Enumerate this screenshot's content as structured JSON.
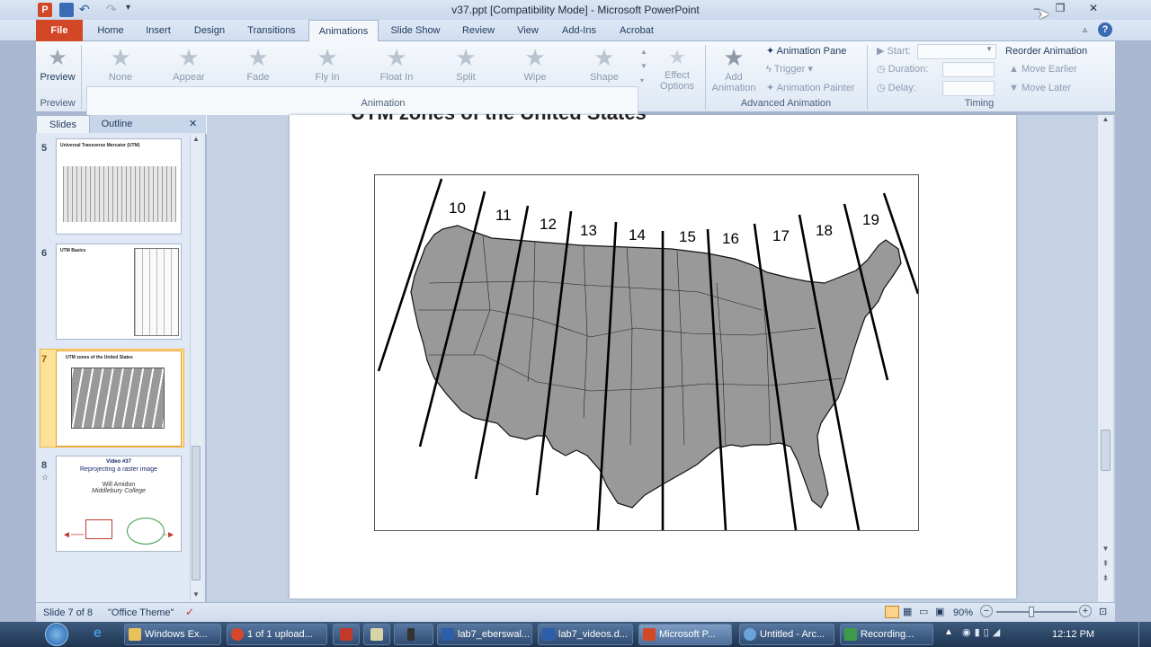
{
  "window": {
    "title": "v37.ppt [Compatibility Mode] - Microsoft PowerPoint",
    "min_label": "–",
    "max_label": "❐",
    "close_label": "✕"
  },
  "ribbon_tabs": [
    "File",
    "Home",
    "Insert",
    "Design",
    "Transitions",
    "Animations",
    "Slide Show",
    "Review",
    "View",
    "Add-Ins",
    "Acrobat"
  ],
  "active_tab": "Animations",
  "preview": {
    "label": "Preview",
    "group": "Preview"
  },
  "animations": [
    "None",
    "Appear",
    "Fade",
    "Fly In",
    "Float In",
    "Split",
    "Wipe",
    "Shape"
  ],
  "animation_group_label": "Animation",
  "effect_options": {
    "line1": "Effect",
    "line2": "Options"
  },
  "add_animation": {
    "line1": "Add",
    "line2": "Animation"
  },
  "advanced": {
    "pane": "Animation Pane",
    "trigger": "Trigger",
    "painter": "Animation Painter",
    "group": "Advanced Animation"
  },
  "timing": {
    "start": "Start:",
    "duration": "Duration:",
    "delay": "Delay:",
    "reorder": "Reorder Animation",
    "earlier": "Move Earlier",
    "later": "Move Later",
    "group": "Timing"
  },
  "panel": {
    "tab_slides": "Slides",
    "tab_outline": "Outline",
    "close": "✕"
  },
  "slides": [
    {
      "num": "5",
      "title": "Universal Transverse Mercator (UTM)"
    },
    {
      "num": "6",
      "title": "UTM Basics"
    },
    {
      "num": "7",
      "title": "UTM zones of the United States"
    },
    {
      "num": "8",
      "title": "Video #37",
      "subtitle": "Reprojecting a raster image",
      "author": "Will Amidon",
      "affil": "Middlebury College"
    }
  ],
  "slide_title": "UTM zones of the United States",
  "zones": [
    "10",
    "11",
    "12",
    "13",
    "14",
    "15",
    "16",
    "17",
    "18",
    "19"
  ],
  "status": {
    "slide": "Slide 7 of 8",
    "theme": "\"Office Theme\"",
    "zoom": "90%"
  },
  "taskbar": {
    "tasks": [
      "Windows Ex...",
      "1 of 1 upload...",
      "",
      "",
      "",
      "lab7_eberswal...",
      "lab7_videos.d...",
      "Microsoft P...",
      "Untitled - Arc...",
      "Recording..."
    ],
    "clock": "12:12 PM"
  },
  "colors": {
    "file_tab": "#d24726",
    "selected_slide": "#fde197",
    "map_fill": "#999999"
  }
}
